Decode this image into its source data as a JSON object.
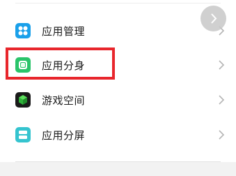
{
  "settings": {
    "items": [
      {
        "label": "应用管理",
        "icon": "apps-grid-icon",
        "color": "#1aa0ea"
      },
      {
        "label": "应用分身",
        "icon": "app-clone-icon",
        "color": "#2ac46a"
      },
      {
        "label": "游戏空间",
        "icon": "game-cube-icon",
        "color": "#1a1a1a"
      },
      {
        "label": "应用分屏",
        "icon": "split-screen-icon",
        "color": "#35c4cf"
      }
    ]
  },
  "highlight_color": "#e8262c"
}
